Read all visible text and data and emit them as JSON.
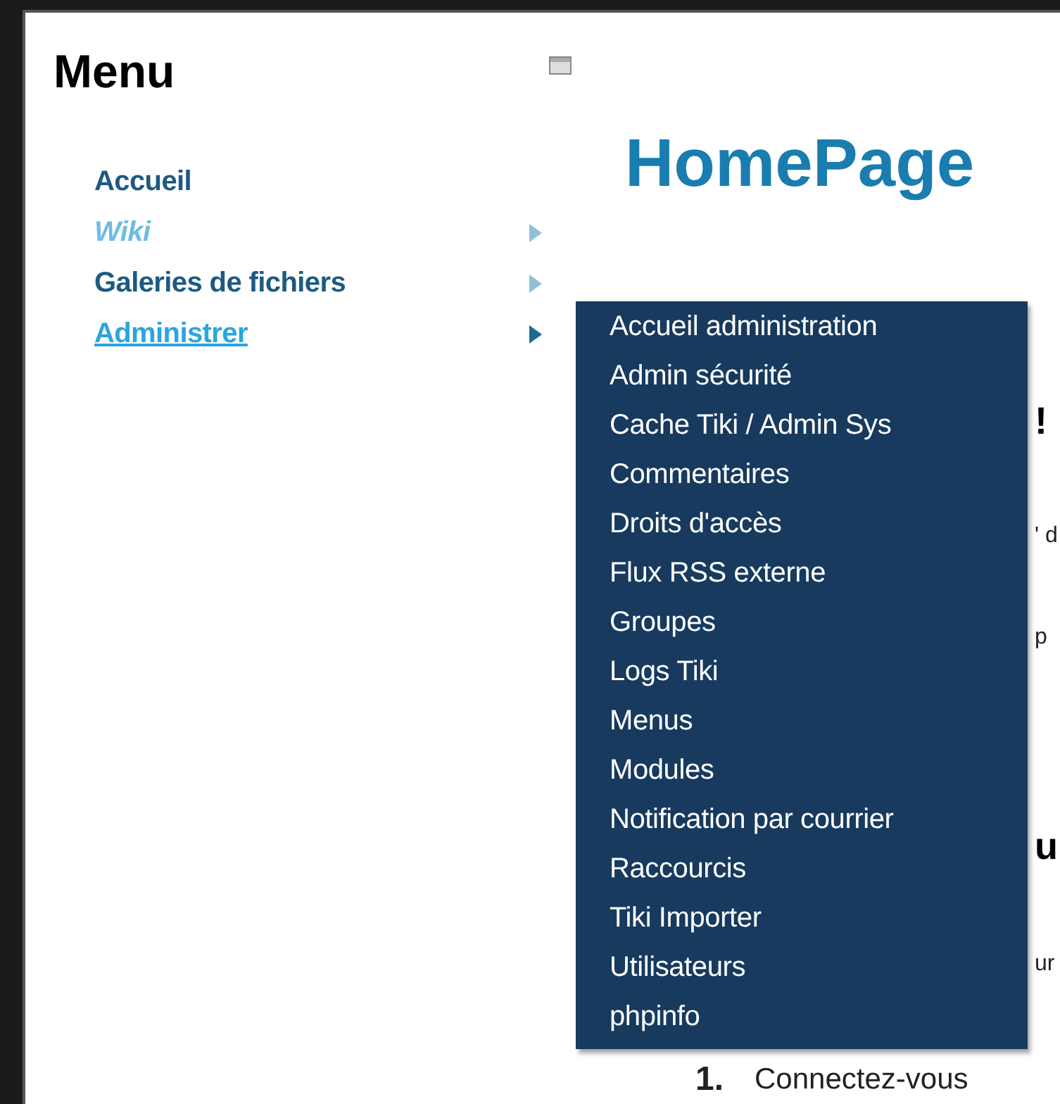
{
  "sidebar": {
    "title": "Menu",
    "items": [
      {
        "label": "Accueil",
        "has_submenu": false,
        "disabled": false,
        "expanded": false
      },
      {
        "label": "Wiki",
        "has_submenu": true,
        "disabled": true,
        "expanded": false
      },
      {
        "label": "Galeries de fichiers",
        "has_submenu": true,
        "disabled": false,
        "expanded": false
      },
      {
        "label": "Administrer",
        "has_submenu": true,
        "disabled": false,
        "expanded": true
      }
    ]
  },
  "page": {
    "title": "HomePage",
    "fragments": [
      {
        "text": "!",
        "kind": "heading"
      },
      {
        "text": "' d",
        "kind": "text"
      },
      {
        "text": "p",
        "kind": "text"
      },
      {
        "text": "u",
        "kind": "heading"
      },
      {
        "text": "ur",
        "kind": "text"
      }
    ],
    "list_number": "1.",
    "list_text": "Connectez-vous"
  },
  "submenu": {
    "items": [
      "Accueil administration",
      "Admin sécurité",
      "Cache Tiki / Admin Sys",
      "Commentaires",
      "Droits d'accès",
      "Flux RSS externe",
      "Groupes",
      "Logs Tiki",
      "Menus",
      "Modules",
      "Notification par courrier",
      "Raccourcis",
      "Tiki Importer",
      "Utilisateurs",
      "phpinfo"
    ]
  }
}
